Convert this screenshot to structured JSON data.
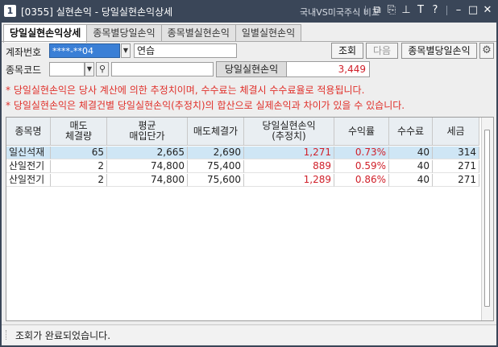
{
  "window": {
    "number": "1",
    "title": "[0355] 실현손익 - 당일실현손익상세",
    "subtitle": "국내VS미국주식 비교"
  },
  "titlebar_icons": [
    "restore-window-icon",
    "new-window-icon",
    "pin-icon",
    "text-size-icon",
    "help-icon",
    "minimize-icon",
    "maximize-icon",
    "close-icon"
  ],
  "tabs": [
    {
      "label": "당일실현손익상세",
      "active": true
    },
    {
      "label": "종목별당일손익",
      "active": false
    },
    {
      "label": "종목별실현손익",
      "active": false
    },
    {
      "label": "일별실현손익",
      "active": false
    }
  ],
  "form": {
    "account_label": "계좌번호",
    "account_value": "****-**04",
    "account_name": "연습",
    "stock_label": "종목코드",
    "stock_code": "",
    "stock_name": "",
    "query_button": "조회",
    "next_button": "다음",
    "by_stock_button": "종목별당일손익",
    "profit_label": "당일실현손익",
    "profit_value": "3,449"
  },
  "notes": [
    "* 당일실현손익은 당사 계산에 의한 추정치이며, 수수료는 체결시 수수료율로 적용됩니다.",
    "* 당일실현손익은 체결건별 당일실현손익(추정치)의 합산으로 실제손익과 차이가 있을 수 있습니다."
  ],
  "table": {
    "columns": [
      "종목명",
      "매도\n체결량",
      "평균\n매입단가",
      "매도체결가",
      "당일실현손익\n(추정치)",
      "수익률",
      "수수료",
      "세금"
    ],
    "rows": [
      {
        "name": "일신석재",
        "qty": "65",
        "avg_price": "2,665",
        "sell_price": "2,690",
        "profit": "1,271",
        "rate": "0.73%",
        "fee": "40",
        "tax": "314",
        "selected": true
      },
      {
        "name": "산일전기",
        "qty": "2",
        "avg_price": "74,800",
        "sell_price": "75,400",
        "profit": "889",
        "rate": "0.59%",
        "fee": "40",
        "tax": "271",
        "selected": false
      },
      {
        "name": "산일전기",
        "qty": "2",
        "avg_price": "74,800",
        "sell_price": "75,600",
        "profit": "1,289",
        "rate": "0.86%",
        "fee": "40",
        "tax": "271",
        "selected": false
      }
    ]
  },
  "status": {
    "message": "조회가 완료되었습니다."
  },
  "colors": {
    "titlebar": "#3a4658",
    "account_highlight": "#3a7fd6",
    "profit_red": "#d0202a",
    "selected_row": "#cfe6f5"
  }
}
